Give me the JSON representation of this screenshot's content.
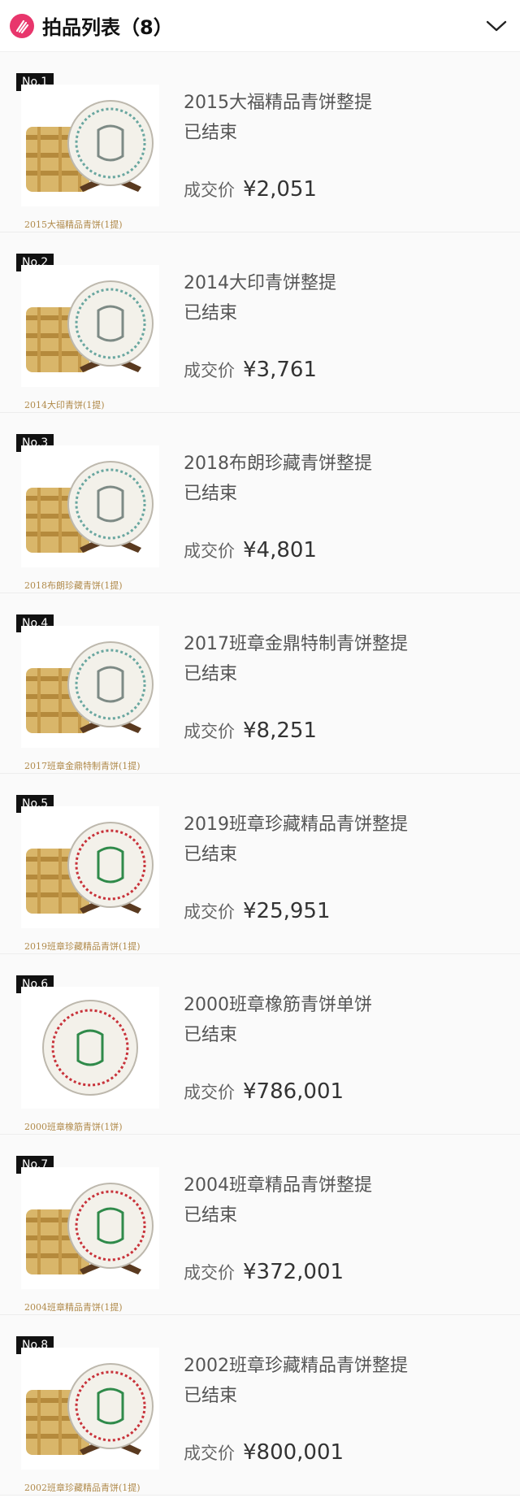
{
  "header": {
    "title": "拍品列表（8）"
  },
  "items": [
    {
      "no": "No.1",
      "name": "2015大福精品青饼整提",
      "status": "已结束",
      "price_label": "成交价",
      "price": "¥2,051",
      "caption": "2015大福精品青饼(1提)"
    },
    {
      "no": "No.2",
      "name": "2014大印青饼整提",
      "status": "已结束",
      "price_label": "成交价",
      "price": "¥3,761",
      "caption": "2014大印青饼(1提)"
    },
    {
      "no": "No.3",
      "name": "2018布朗珍藏青饼整提",
      "status": "已结束",
      "price_label": "成交价",
      "price": "¥4,801",
      "caption": "2018布朗珍藏青饼(1提)"
    },
    {
      "no": "No.4",
      "name": "2017班章金鼎特制青饼整提",
      "status": "已结束",
      "price_label": "成交价",
      "price": "¥8,251",
      "caption": "2017班章金鼎特制青饼(1提)"
    },
    {
      "no": "No.5",
      "name": "2019班章珍藏精品青饼整提",
      "status": "已结束",
      "price_label": "成交价",
      "price": "¥25,951",
      "caption": "2019班章珍藏精品青饼(1提)"
    },
    {
      "no": "No.6",
      "name": "2000班章橡筋青饼单饼",
      "status": "已结束",
      "price_label": "成交价",
      "price": "¥786,001",
      "caption": "2000班章橡筋青饼(1饼)"
    },
    {
      "no": "No.7",
      "name": "2004班章精品青饼整提",
      "status": "已结束",
      "price_label": "成交价",
      "price": "¥372,001",
      "caption": "2004班章精品青饼(1提)"
    },
    {
      "no": "No.8",
      "name": "2002班章珍藏精品青饼整提",
      "status": "已结束",
      "price_label": "成交价",
      "price": "¥800,001",
      "caption": "2002班章珍藏精品青饼(1提)"
    }
  ],
  "icons": {
    "logo": "auction-logo-icon",
    "collapse": "chevron-down-icon"
  },
  "colors": {
    "accent": "#e8366c",
    "badge": "#111111",
    "caption": "#b08a4a"
  }
}
